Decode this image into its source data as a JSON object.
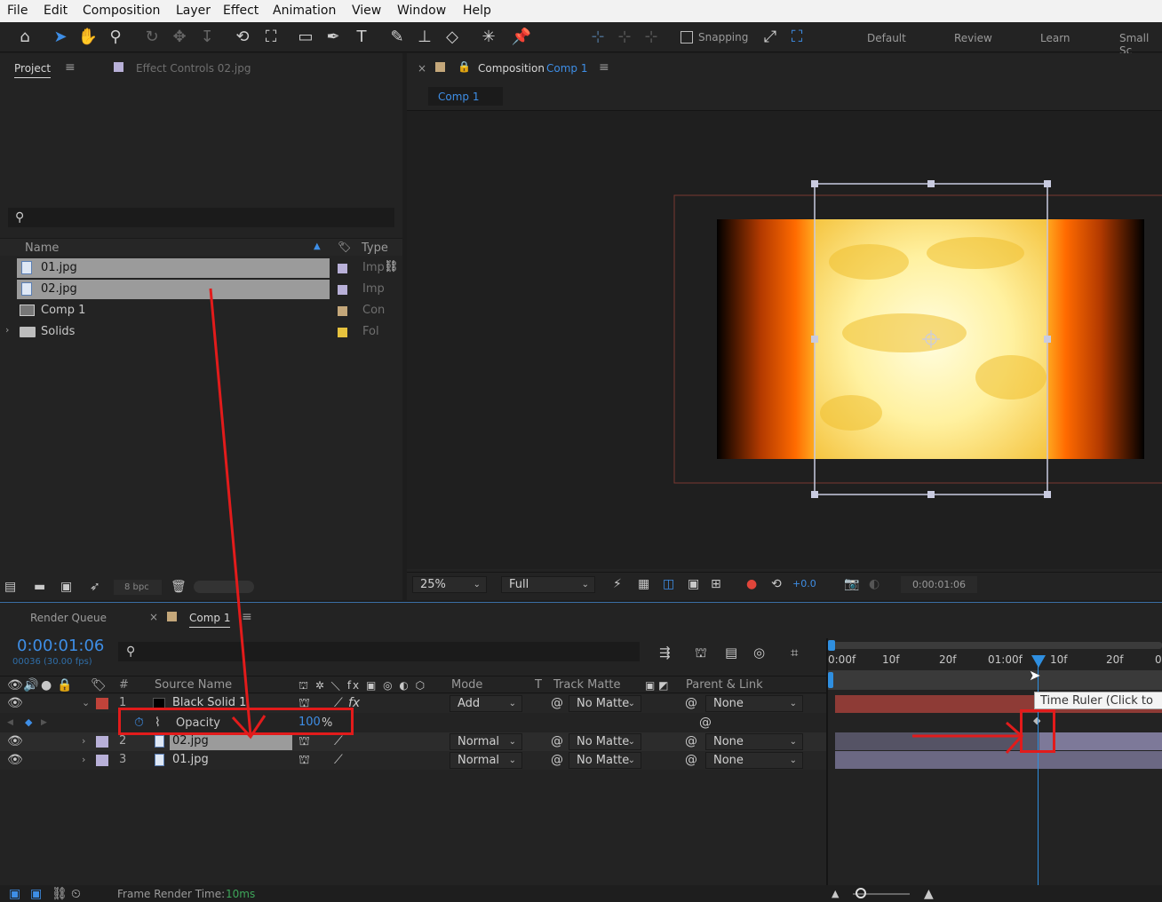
{
  "menu": [
    "File",
    "Edit",
    "Composition",
    "Layer",
    "Effect",
    "Animation",
    "View",
    "Window",
    "Help"
  ],
  "toolbar": {
    "snapping_label": "Snapping",
    "workspaces": [
      "Default",
      "Review",
      "Learn",
      "Small Sc"
    ]
  },
  "project_panel": {
    "tab_label": "Project",
    "effect_controls_label": "Effect Controls 02.jpg",
    "search_icon": "⚲",
    "columns": {
      "name": "Name",
      "type": "Type"
    },
    "items": [
      {
        "name": "01.jpg",
        "type": "Imp",
        "color": "#b8b0d8",
        "selected": true
      },
      {
        "name": "02.jpg",
        "type": "Imp",
        "color": "#b8b0d8",
        "selected": true
      },
      {
        "name": "Comp 1",
        "type": "Con",
        "color": "#c4a77a",
        "selected": false
      },
      {
        "name": "Solids",
        "type": "Fol",
        "color": "#e6c23e",
        "selected": false
      }
    ],
    "bpc_label": "8 bpc"
  },
  "composition_panel": {
    "tab_prefix": "Composition",
    "tab_comp": "Comp 1",
    "subtab": "Comp 1",
    "zoom": "25%",
    "resolution": "Full",
    "exposure": "+0.0",
    "timecode": "0:00:01:06"
  },
  "timeline": {
    "render_queue_label": "Render Queue",
    "comp_tab": "Comp 1",
    "current_time": "0:00:01:06",
    "frame_info": "00036 (30.00 fps)",
    "ruler_labels": [
      "0:00f",
      "10f",
      "20f",
      "01:00f",
      "10f",
      "20f",
      "0"
    ],
    "tooltip": "Time Ruler (Click to",
    "columns": {
      "num": "#",
      "source_name": "Source Name",
      "mode": "Mode",
      "t": "T",
      "track_matte": "Track Matte",
      "parent": "Parent & Link"
    },
    "layers": [
      {
        "num": "1",
        "name": "Black Solid 1",
        "mode": "Add",
        "matte": "No Matte",
        "parent": "None",
        "label_color": "#c0433a"
      },
      {
        "num": "2",
        "name": "02.jpg",
        "mode": "Normal",
        "matte": "No Matte",
        "parent": "None",
        "label_color": "#b8b0d8"
      },
      {
        "num": "3",
        "name": "01.jpg",
        "mode": "Normal",
        "matte": "No Matte",
        "parent": "None",
        "label_color": "#b8b0d8"
      }
    ],
    "property": {
      "name": "Opacity",
      "value": "100",
      "unit": "%"
    },
    "status": {
      "label": "Frame Render Time:",
      "value": "10ms"
    }
  }
}
